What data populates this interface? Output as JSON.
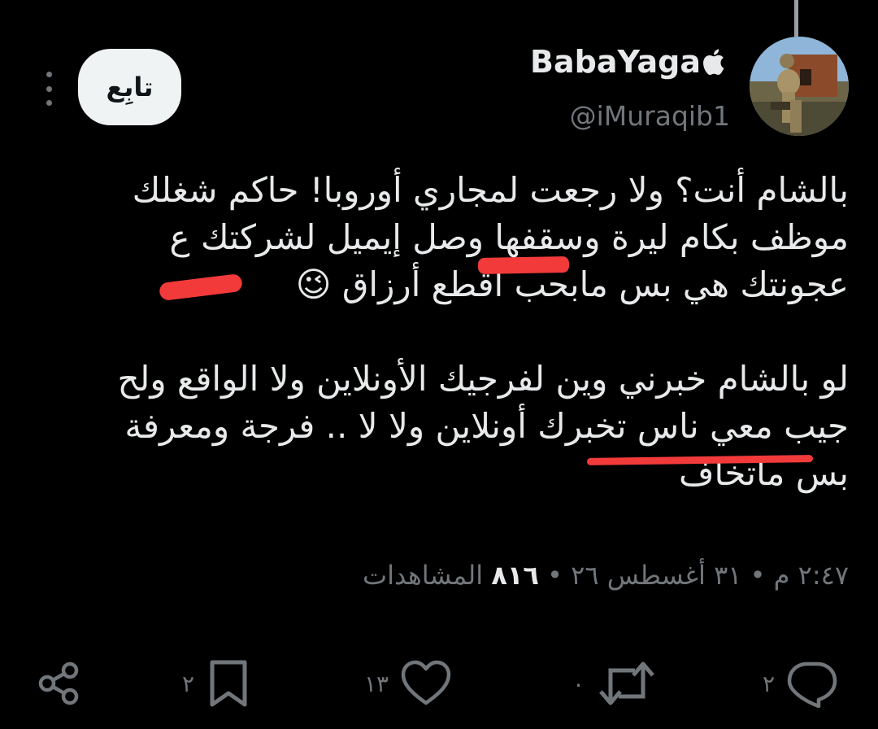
{
  "author": {
    "display_name": "BabaYaga",
    "handle": "@iMuraqib1",
    "badge_icon": "apple-icon"
  },
  "follow_button": {
    "label": "تابِع"
  },
  "tweet": {
    "paragraph1": "بالشام أنت؟ ولا رجعت لمجاري أوروبا! حاكم شغلك موظف بكام ليرة وسقفها وصل إيميل لشركتك ع عجونتك هي بس مابحب اقطع أرزاق 😉",
    "paragraph2": "لو بالشام خبرني وين لفرجيك الأونلاين ولا الواقع ولح جيب معي ناس تخبرك أونلاين ولا لا .. فرجة ومعرفة بس ماتخاف"
  },
  "meta": {
    "time": "٢:٤٧ م",
    "date": "٣١ أغسطس ٢٦",
    "views_count": "٨١٦",
    "views_label": "المشاهدات",
    "separator": "•"
  },
  "actions": {
    "replies": "٢",
    "retweets": "٠",
    "likes": "١٣",
    "bookmarks": "٢"
  },
  "colors": {
    "background": "#000000",
    "primary_text": "#e7e9ea",
    "secondary_text": "#71767b",
    "follow_button_bg": "#eff3f4",
    "annotation_red": "#f23a3a"
  }
}
